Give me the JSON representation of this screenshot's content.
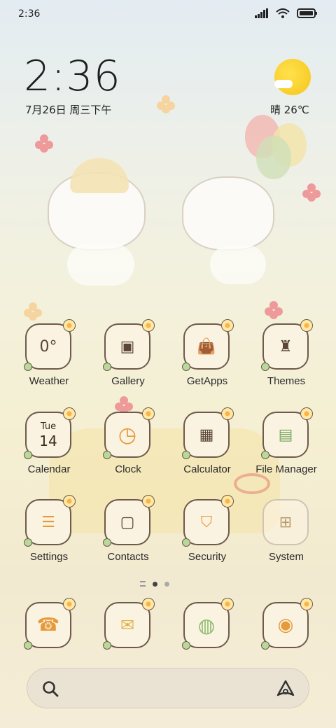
{
  "status_bar": {
    "time": "2:36",
    "icons": [
      "signal-icon",
      "wifi-icon",
      "battery-icon"
    ]
  },
  "clock_widget": {
    "time": "2:36",
    "date": "7月26日 周三下午",
    "weather": "晴 26℃",
    "weather_icon": "sun-cloud-icon"
  },
  "apps": [
    {
      "label": "Weather",
      "icon": "weather-icon",
      "glyph": "0°"
    },
    {
      "label": "Gallery",
      "icon": "gallery-icon",
      "glyph": "▣"
    },
    {
      "label": "GetApps",
      "icon": "getapps-icon",
      "glyph": "👜"
    },
    {
      "label": "Themes",
      "icon": "themes-icon",
      "glyph": "♜"
    },
    {
      "label": "Calendar",
      "icon": "calendar-icon",
      "glyph_day": "Tue",
      "glyph_date": "14"
    },
    {
      "label": "Clock",
      "icon": "clock-icon",
      "glyph": "◷"
    },
    {
      "label": "Calculator",
      "icon": "calculator-icon",
      "glyph": "▦"
    },
    {
      "label": "File Manager",
      "icon": "file-manager-icon",
      "glyph": "▤"
    },
    {
      "label": "Settings",
      "icon": "settings-icon",
      "glyph": "☰"
    },
    {
      "label": "Contacts",
      "icon": "contacts-icon",
      "glyph": "▢"
    },
    {
      "label": "Security",
      "icon": "security-icon",
      "glyph": "⛉"
    },
    {
      "label": "System",
      "icon": "system-folder-icon",
      "glyph": "⊞"
    }
  ],
  "dock": [
    {
      "icon": "phone-icon",
      "glyph": "☎"
    },
    {
      "icon": "messages-icon",
      "glyph": "✉"
    },
    {
      "icon": "browser-icon",
      "glyph": "◍"
    },
    {
      "icon": "camera-icon",
      "glyph": "◉"
    }
  ],
  "page_indicator": {
    "pages": 2,
    "active": 0
  },
  "search_bar": {
    "icon": "search-icon",
    "assistant_icon": "assistant-icon"
  },
  "colors": {
    "accent_sun": "#f6c51a",
    "icon_border": "#6e5a4a",
    "icon_bg": "#fbf3e1"
  }
}
